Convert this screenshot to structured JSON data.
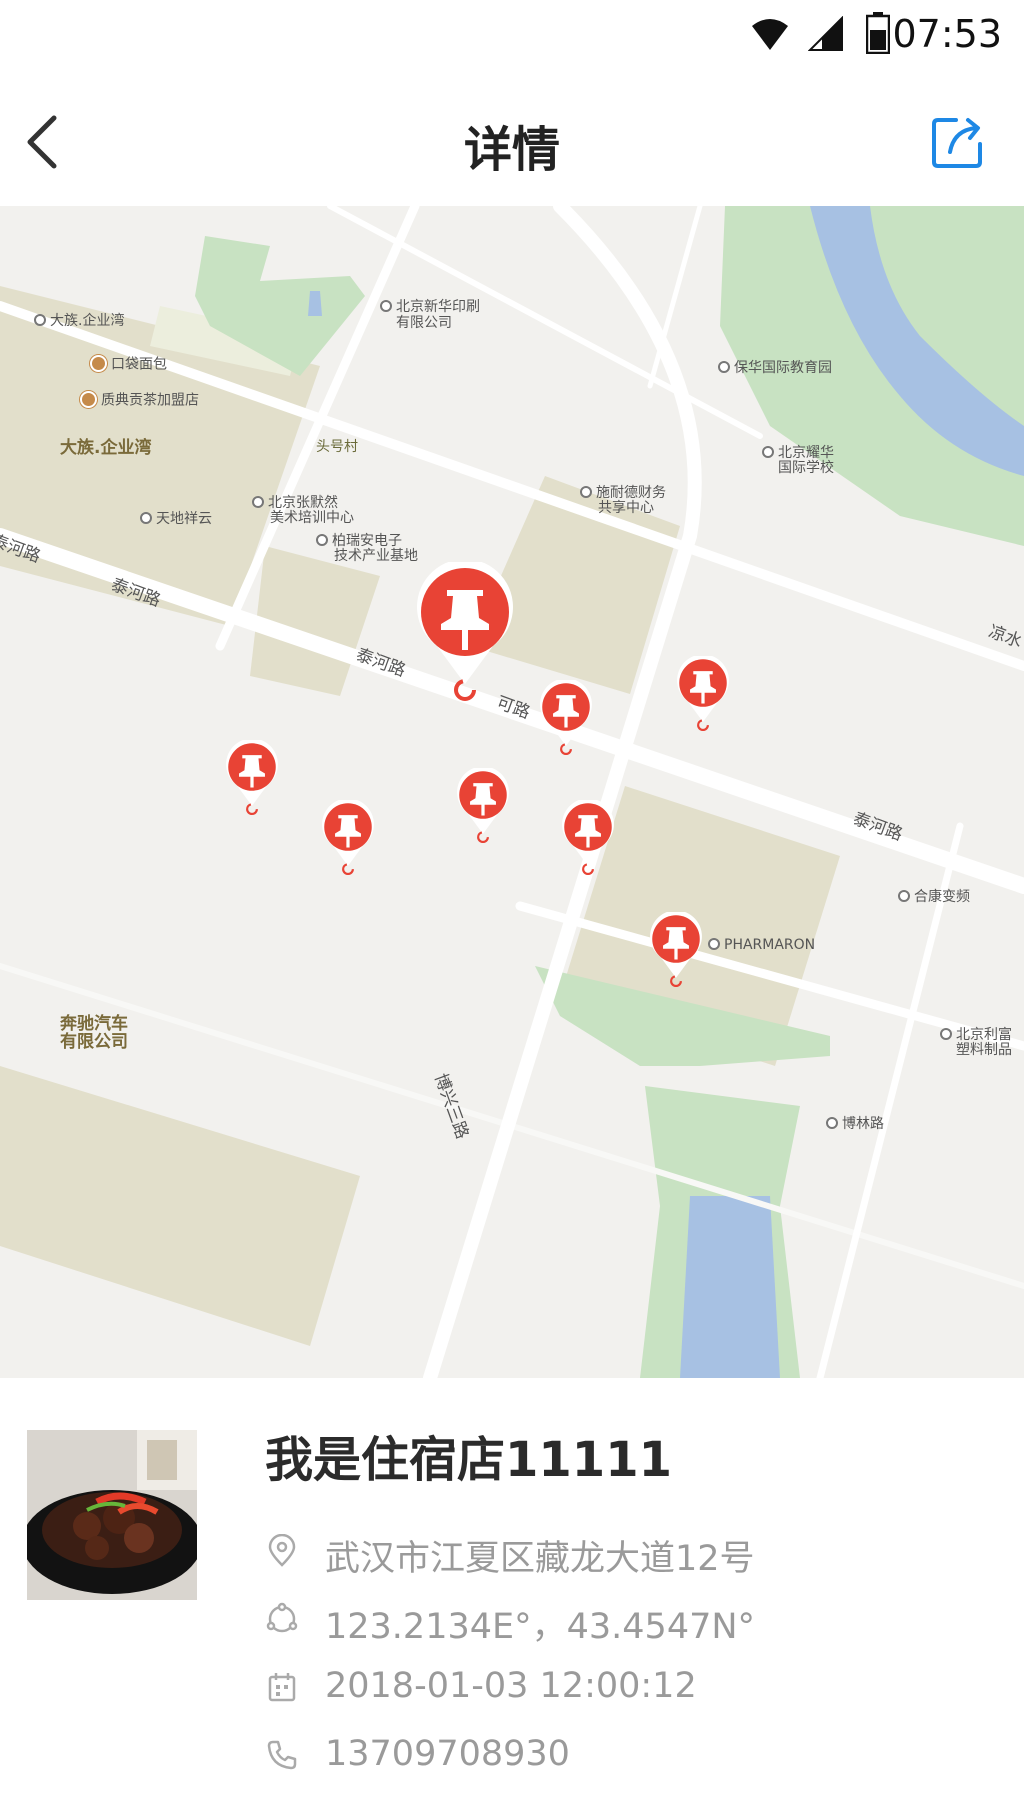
{
  "status_bar": {
    "time": "07:53",
    "icons": [
      "wifi-icon",
      "signal-icon",
      "battery-icon"
    ]
  },
  "header": {
    "title": "详情",
    "back_icon": "chevron-left-icon",
    "share_icon": "share-icon"
  },
  "colors": {
    "accent": "#1e88e5",
    "pin_red": "#e84335",
    "map_bg": "#f2f1ee",
    "block": "#e2dfcb",
    "green": "#c8e2c2",
    "water": "#a7c1e3"
  },
  "map": {
    "labels": {
      "dazu_wan": "大族.企业湾",
      "kou_dai": "口袋面包",
      "zhidian": "质典贡茶加盟店",
      "dazu_big": "大族.企业湾",
      "tianditai": "天地祥云",
      "xinhua_1": "北京新华印刷",
      "xinhua_2": "有限公司",
      "touhao": "头号村",
      "zhangmo_1": "北京张默然",
      "zhangmo_2": "美术培训中心",
      "bairui_1": "柏瑞安电子",
      "bairui_2": "技术产业基地",
      "shinaide_1": "施耐德财务",
      "shinaide_2": "共享中心",
      "baohua": "保华国际教育园",
      "yaohua_1": "北京耀华",
      "yaohua_2": "国际学校",
      "taihe_1": "泰河路",
      "taihe_2": "泰河路",
      "taihe_3": "泰河路",
      "taihe_4": "可路",
      "taihe_5": "泰河路",
      "liangshui": "凉水",
      "hekang": "合康变频",
      "pharmaron": "PHARMARON",
      "benchi_1": "奔驰汽车",
      "benchi_2": "有限公司",
      "bolin": "博林路",
      "lifu_1": "北京利富",
      "lifu_2": "塑料制品",
      "boxing": "博兴三路"
    },
    "pin_count": 8
  },
  "detail": {
    "name": "我是住宿店11111",
    "thumbnail": "braised-meat-dish-photo",
    "address_icon": "location-pin-icon",
    "address": "武汉市江夏区藏龙大道12号",
    "coords_icon": "compass-icon",
    "coords": "123.2134E°，43.4547N°",
    "time_icon": "calendar-icon",
    "time": "2018-01-03  12:00:12",
    "phone_icon": "phone-icon",
    "phone": "13709708930"
  }
}
